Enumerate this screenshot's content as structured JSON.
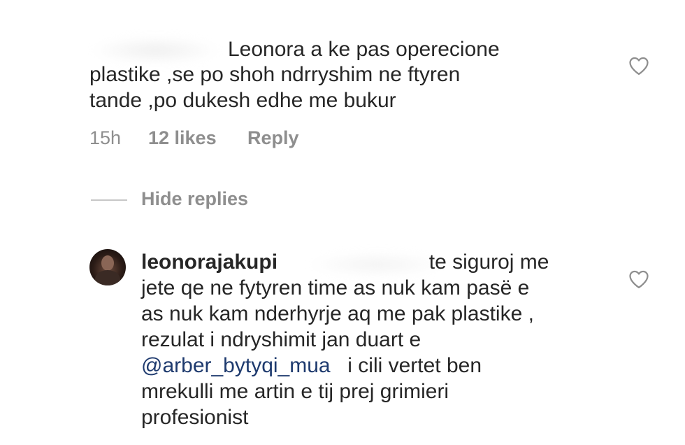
{
  "comment": {
    "line1": "Leonora a ke pas operecione",
    "line2": "plastike ,se po shoh ndrryshim ne ftyren",
    "line3": "tande ,po dukesh edhe me bukur",
    "time": "15h",
    "likes": "12 likes",
    "reply_label": "Reply"
  },
  "hide_replies_label": "Hide replies",
  "reply": {
    "username": "leonorajakupi",
    "line1_tail": "te siguroj me",
    "line2": "jete qe ne fytyren time as nuk kam pasë e",
    "line3": "as nuk kam nderhyrje aq me pak plastike ,",
    "line4": "rezulat i ndryshimit jan duart e",
    "mention": "@arber_bytyqi_mua",
    "line5_tail": "i cili vertet ben",
    "line6": "mrekulli me artin e tij prej grimieri",
    "line7": "profesionist"
  },
  "icons": {
    "like_top": "heart-outline-icon",
    "like_reply": "heart-outline-icon"
  },
  "colors": {
    "text": "#262626",
    "meta": "#8e8e8e",
    "mention": "#1e3a6e",
    "heart_stroke": "#8e8e8e"
  }
}
